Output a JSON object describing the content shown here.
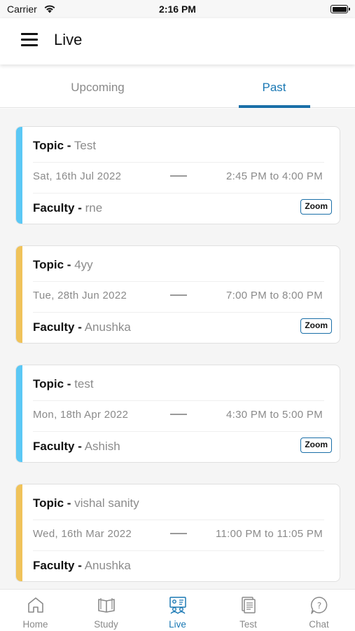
{
  "status_bar": {
    "carrier": "Carrier",
    "time": "2:16 PM"
  },
  "header": {
    "title": "Live"
  },
  "tabs": [
    {
      "label": "Upcoming",
      "active": false
    },
    {
      "label": "Past",
      "active": true
    }
  ],
  "colors": {
    "accent": "#1a78b4",
    "stripe_blue": "#5bc8f5",
    "stripe_yellow": "#f0c35a"
  },
  "sessions": [
    {
      "topic_label": "Topic -",
      "topic": "Test",
      "date": "Sat, 16th Jul 2022",
      "time": "2:45 PM to 4:00 PM",
      "faculty_label": "Faculty -",
      "faculty": "rne",
      "platform": "Zoom",
      "stripe": "blue"
    },
    {
      "topic_label": "Topic -",
      "topic": "4yy",
      "date": "Tue, 28th Jun 2022",
      "time": "7:00 PM to 8:00 PM",
      "faculty_label": "Faculty -",
      "faculty": "Anushka",
      "platform": "Zoom",
      "stripe": "yellow"
    },
    {
      "topic_label": "Topic -",
      "topic": "test",
      "date": "Mon, 18th Apr 2022",
      "time": "4:30 PM to 5:00 PM",
      "faculty_label": "Faculty -",
      "faculty": "Ashish",
      "platform": "Zoom",
      "stripe": "blue"
    },
    {
      "topic_label": "Topic -",
      "topic": "vishal sanity",
      "date": "Wed, 16th Mar 2022",
      "time": "11:00 PM to 11:05 PM",
      "faculty_label": "Faculty -",
      "faculty": "Anushka",
      "platform": "",
      "stripe": "yellow"
    }
  ],
  "bottom_nav": [
    {
      "label": "Home",
      "icon": "home-icon",
      "active": false
    },
    {
      "label": "Study",
      "icon": "book-icon",
      "active": false
    },
    {
      "label": "Live",
      "icon": "live-class-icon",
      "active": true
    },
    {
      "label": "Test",
      "icon": "test-paper-icon",
      "active": false
    },
    {
      "label": "Chat",
      "icon": "help-chat-icon",
      "active": false
    }
  ]
}
